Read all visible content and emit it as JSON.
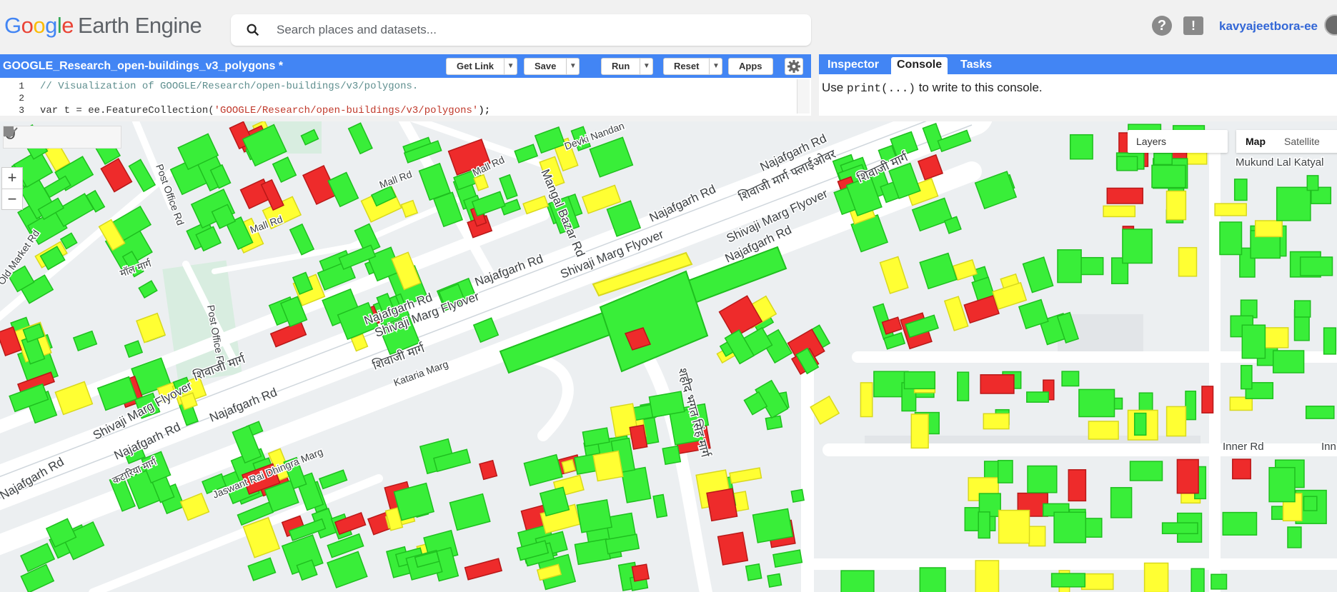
{
  "header": {
    "logo_google": [
      "G",
      "o",
      "o",
      "g",
      "l",
      "e"
    ],
    "logo_rest": "Earth Engine",
    "search_placeholder": "Search places and datasets...",
    "help_icon_glyph": "?",
    "feedback_icon_glyph": "!",
    "user_name": "kavyajeetbora-ee"
  },
  "editor": {
    "title": "GOOGLE_Research_open-buildings_v3_polygons *",
    "buttons": [
      "Get Link",
      "Save",
      "Run",
      "Reset",
      "Apps"
    ],
    "lines": [
      {
        "num": "1",
        "text": "// Visualization of GOOGLE/Research/open-buildings/v3/polygons."
      },
      {
        "num": "2",
        "text": ""
      },
      {
        "num": "3",
        "pre": "var t = ee.FeatureCollection(",
        "str": "'GOOGLE/Research/open-buildings/v3/polygons'",
        "post": ");"
      }
    ]
  },
  "console": {
    "tabs": [
      "Inspector",
      "Console",
      "Tasks"
    ],
    "active_tab": "Console",
    "msg_pre": "Use ",
    "msg_code": "print(...)",
    "msg_post": " to write to this console."
  },
  "map": {
    "zoom_in": "+",
    "zoom_out": "−",
    "layers_label": "Layers",
    "map_type": "Map",
    "satellite_type": "Satellite",
    "labels": {
      "post_office_rd_1": "Post Office Rd",
      "post_office_rd_2": "Post Office Rd",
      "mall_rd_1": "Mall Rd",
      "mall_rd_2": "Mall Rd",
      "mall_rd_3": "Mall Rd",
      "old_market_rd": "Old Market Rd",
      "maal_marg": "मॉल मार्ग",
      "devki_nandan": "Devki Nandan",
      "mangal_bazar_rd": "Mangal Bazar Rd",
      "najafgarh_1": "Najafgarh Rd",
      "najafgarh_2": "Najafgarh Rd",
      "najafgarh_3": "Najafgarh Rd",
      "najafgarh_4": "Najafgarh Rd",
      "najafgarh_5": "Najafgarh Rd",
      "najafgarh_6": "Najafgarh Rd",
      "najafgarh_7": "Najafgarh Rd",
      "najafgarh_8": "Najafgarh Rd",
      "shivaji_hi_flyover": "शिवाजी मार्ग फ्लाईओवर",
      "shivaji_hi_1": "शिवाजी मार्ग",
      "shivaji_hi_2": "शिवाजी मार्ग",
      "shivaji_hi_3": "शिवाजी मार्ग",
      "shivaji_flyover_1": "Shivaji Marg Flyover",
      "shivaji_flyover_2": "Shivaji Marg Flyover",
      "shivaji_flyover_3": "Shivaji Marg Flyover",
      "shivaji_flyover_4": "Shivaji Marg Flyover",
      "kataria_marg": "Kataria Marg",
      "kataria_hi": "कटारिया मार्ग",
      "jaswant_rai": "Jaswant Rai Dhingra Marg",
      "shaheed_bhagat": "शहीद भगत सिंह मार्ग",
      "mukund_lal": "Mukund Lal Katyal",
      "inner_rd": "Inner Rd",
      "inn": "Inn"
    },
    "colors": {
      "green": "#39ee39",
      "yellow": "#ffff33",
      "red": "#ee2b2b",
      "road": "#ffffff",
      "background": "#eceff1"
    }
  }
}
